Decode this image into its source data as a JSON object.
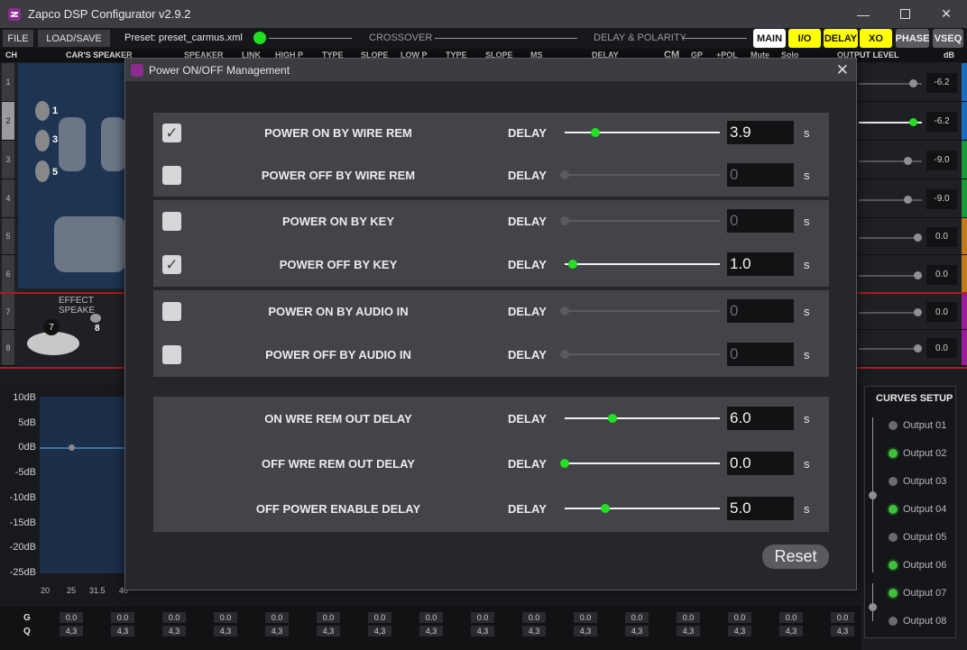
{
  "window": {
    "title": "Zapco DSP Configurator v2.9.2"
  },
  "toolbar": {
    "file": "FILE",
    "load_save": "LOAD/SAVE",
    "preset": "Preset: preset_carmus.xml",
    "crossover": "CROSSOVER",
    "delay_polarity": "DELAY & POLARITY",
    "nav": [
      {
        "label": "MAIN",
        "bg": "#ffffff"
      },
      {
        "label": "I/O",
        "bg": "#ffff00"
      },
      {
        "label": "DELAY",
        "bg": "#ffff00"
      },
      {
        "label": "XO",
        "bg": "#ffff00"
      },
      {
        "label": "PHASE",
        "bg": "#5a5b60"
      },
      {
        "label": "VSEQ",
        "bg": "#5a5b60"
      }
    ]
  },
  "columns": {
    "ch": "CH",
    "cars_speaker": "CAR'S SPEAKER",
    "speaker": "SPEAKER",
    "link": "LINK",
    "high_p": "HIGH P",
    "type1": "TYPE",
    "slope1": "SLOPE",
    "low_p": "LOW P",
    "type2": "TYPE",
    "slope2": "SLOPE",
    "ms": "MS",
    "delay": "DELAY",
    "cm": "CM",
    "gp": "GP",
    "pol": "+POL",
    "mute": "Mute",
    "solo": "Solo",
    "output_level": "OUTPUT LEVEL",
    "db": "dB"
  },
  "speaker_labels": [
    "1",
    "3",
    "5",
    "7",
    "8"
  ],
  "effect_speaker": "EFFECT SPEAKE",
  "channels": [
    {
      "num": "1",
      "level": "-6.2",
      "level_pct": 0.85,
      "color": "#1a6cc0"
    },
    {
      "num": "2",
      "level": "-6.2",
      "level_pct": 0.85,
      "color": "#1a6cc0",
      "selected": true
    },
    {
      "num": "3",
      "level": "-9.0",
      "level_pct": 0.77,
      "color": "#1a9a3a"
    },
    {
      "num": "4",
      "level": "-9.0",
      "level_pct": 0.77,
      "color": "#1a9a3a"
    },
    {
      "num": "5",
      "level": "0.0",
      "level_pct": 0.93,
      "color": "#c07a1a"
    },
    {
      "num": "6",
      "level": "0.0",
      "level_pct": 0.93,
      "color": "#c07a1a"
    },
    {
      "num": "7",
      "level": "0.0",
      "level_pct": 0.93,
      "color": "#9a1a9a"
    },
    {
      "num": "8",
      "level": "0.0",
      "level_pct": 0.93,
      "color": "#9a1a9a"
    }
  ],
  "graph": {
    "y_ticks": [
      "10dB",
      "5dB",
      "0dB",
      "-5dB",
      "-10dB",
      "-15dB",
      "-20dB",
      "-25dB"
    ],
    "x_ticks": [
      "20",
      "25",
      "31.5",
      "40"
    ]
  },
  "gq": {
    "g_label": "G",
    "q_label": "Q",
    "g_values": [
      "0.0",
      "0.0",
      "0.0",
      "0.0",
      "0.0",
      "0.0",
      "0.0",
      "0.0",
      "0.0",
      "0.0",
      "0.0",
      "0.0",
      "0.0",
      "0.0",
      "0.0",
      "0.0"
    ],
    "q_values": [
      "4,3",
      "4,3",
      "4,3",
      "4,3",
      "4,3",
      "4,3",
      "4,3",
      "4,3",
      "4,3",
      "4,3",
      "4,3",
      "4,3",
      "4,3",
      "4,3",
      "4,3",
      "4,3"
    ]
  },
  "curves": {
    "title": "CURVES SETUP",
    "outputs": [
      {
        "label": "Output 01",
        "on": false
      },
      {
        "label": "Output 02",
        "on": true
      },
      {
        "label": "Output 03",
        "on": false
      },
      {
        "label": "Output 04",
        "on": true
      },
      {
        "label": "Output 05",
        "on": false
      },
      {
        "label": "Output 06",
        "on": true
      },
      {
        "label": "Output 07",
        "on": true
      },
      {
        "label": "Output 08",
        "on": false
      }
    ]
  },
  "modal": {
    "title": "Power ON/OFF Management",
    "delay_label": "DELAY",
    "unit": "s",
    "reset": "Reset",
    "rows": [
      {
        "label": "POWER ON BY WIRE REM",
        "checked": true,
        "value": "3.9",
        "fraction": 0.2,
        "active": true
      },
      {
        "label": "POWER OFF BY WIRE REM",
        "checked": false,
        "value": "0",
        "fraction": 0.0,
        "active": false
      },
      {
        "label": "POWER ON BY KEY",
        "checked": false,
        "value": "0",
        "fraction": 0.0,
        "active": false
      },
      {
        "label": "POWER OFF BY KEY",
        "checked": true,
        "value": "1.0",
        "fraction": 0.05,
        "active": true
      },
      {
        "label": "POWER ON BY AUDIO IN",
        "checked": false,
        "value": "0",
        "fraction": 0.0,
        "active": false
      },
      {
        "label": "POWER OFF BY AUDIO IN",
        "checked": false,
        "value": "0",
        "fraction": 0.0,
        "active": false
      }
    ],
    "delay_rows": [
      {
        "label": "ON WRE REM OUT DELAY",
        "value": "6.0",
        "fraction": 0.31
      },
      {
        "label": "OFF WRE REM OUT DELAY",
        "value": "0.0",
        "fraction": 0.0
      },
      {
        "label": "OFF POWER ENABLE DELAY",
        "value": "5.0",
        "fraction": 0.26
      }
    ]
  }
}
